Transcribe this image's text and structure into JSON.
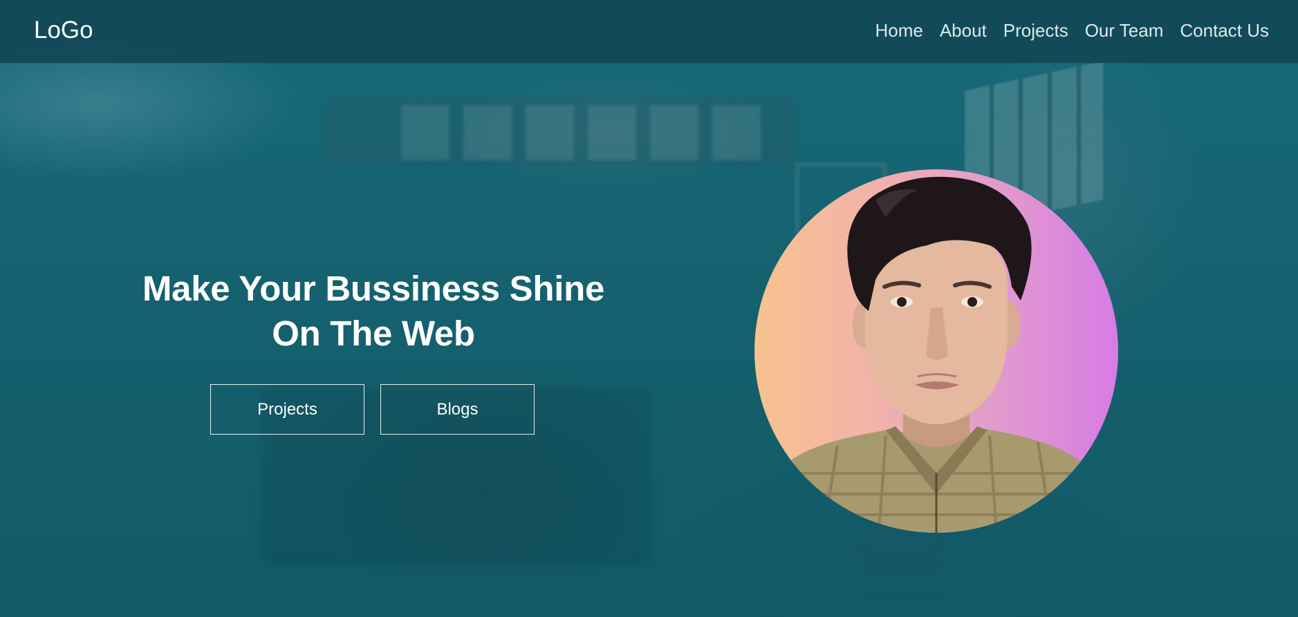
{
  "header": {
    "logo": "LoGo",
    "nav_items": [
      {
        "label": "Home"
      },
      {
        "label": "About"
      },
      {
        "label": "Projects"
      },
      {
        "label": "Our Team"
      },
      {
        "label": "Contact Us"
      }
    ]
  },
  "hero": {
    "headline_line1": "Make Your Bussiness Shine",
    "headline_line2": "On The Web",
    "buttons": {
      "projects": "Projects",
      "blogs": "Blogs"
    }
  },
  "colors": {
    "background": "#14606f",
    "navbar": "#124856",
    "text": "#ffffff",
    "avatar_gradient_start": "#f7c38f",
    "avatar_gradient_end": "#d77be6"
  }
}
